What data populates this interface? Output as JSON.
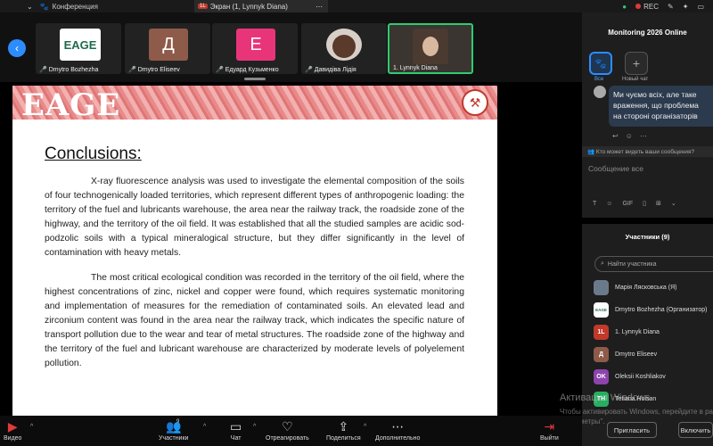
{
  "topbar": {
    "tab1": "Конференция",
    "tab2_badge": "1L",
    "tab2": "Экран (1, Lynnyk Diana)",
    "rec": "REC"
  },
  "strip": {
    "tiles": [
      {
        "label": "EAGE",
        "name": "Dmytro Bozhezha"
      },
      {
        "label": "Д",
        "name": "Dmytro Eliseev"
      },
      {
        "label": "Е",
        "name": "Едуард Кузьменко"
      },
      {
        "label": "",
        "name": "Давидіва Лідія"
      },
      {
        "label": "",
        "name": "1. Lynnyk Diana"
      }
    ]
  },
  "slide": {
    "logo": "EAGE",
    "title": "Conclusions:",
    "para1": "X-ray fluorescence analysis was used to investigate the elemental composition of the soils of four technogenically loaded territories, which represent different types of anthropogenic loading: the territory of the fuel and lubricants warehouse, the area near the railway track, the roadside zone of the highway, and the territory of the oil field. It was established that all the studied samples are acidic sod-podzolic soils with a typical mineralogical structure, but they differ significantly in the level of contamination with heavy metals.",
    "para2": "The most critical ecological condition was recorded in the territory of the oil field, where the highest concentrations of zinc, nickel and copper were found, which requires systematic monitoring and implementation of measures for the remediation of contaminated soils. An elevated lead and zirconium content was found in the area near the railway track, which indicates the specific nature of transport pollution due to the wear and tear of metal structures. The roadside zone of the highway and the territory of the fuel and lubricant warehouse are characterized by moderate levels of polyelement pollution."
  },
  "chat": {
    "title": "Monitoring 2026 Online",
    "all_label": "Все",
    "new_label": "Новый чат",
    "message": "Ми чуємо всіх, але таке враження, що проблема на стороні організаторів",
    "visibility": "Кто может видеть ваши сообщения?",
    "placeholder": "Сообщение все",
    "gif": "GIF"
  },
  "participants": {
    "title": "Участники (9)",
    "search_placeholder": "Найти участника",
    "list": [
      {
        "avatar": "",
        "name": "Марія Лясковська (Я)",
        "color": "#6b7a8a"
      },
      {
        "avatar": "EAGE",
        "name": "Dmytro Bozhezha (Организатор)",
        "color": "#ffffff"
      },
      {
        "avatar": "1L",
        "name": "1. Lynnyk Diana",
        "color": "#c0392b"
      },
      {
        "avatar": "Д",
        "name": "Dmytro Eliseev",
        "color": "#8e5a4a"
      },
      {
        "avatar": "OK",
        "name": "Oleksii Koshliakov",
        "color": "#8e44ad"
      },
      {
        "avatar": "TH",
        "name": "Tetiana Hoisan",
        "color": "#27ae60"
      }
    ],
    "invite": "Пригласить",
    "unmute": "Включить"
  },
  "watermark": {
    "line1": "Активация Windows",
    "line2": "Чтобы активировать Windows, перейдите в раздел",
    "line3": "\"Параметры\"."
  },
  "toolbar": {
    "video": "Видео",
    "participants": "Участники",
    "participants_count": "9",
    "chat": "Чат",
    "react": "Отреагировать",
    "share": "Поделиться",
    "more": "Дополнительно",
    "leave": "Выйти"
  }
}
